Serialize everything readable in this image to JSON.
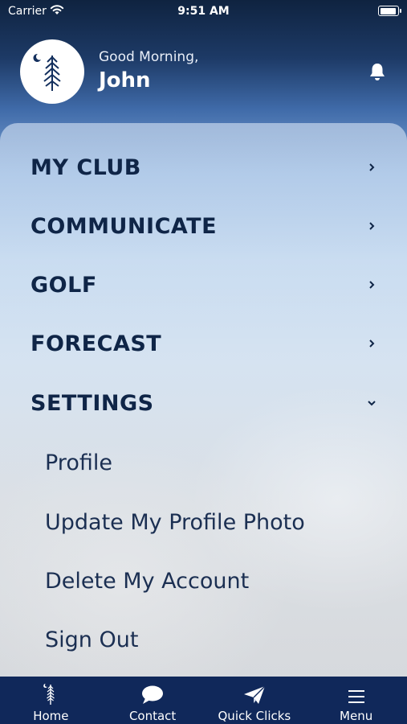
{
  "status_bar": {
    "carrier": "Carrier",
    "time": "9:51 AM"
  },
  "header": {
    "greeting": "Good Morning,",
    "name": "John"
  },
  "colors": {
    "navy": "#10285a",
    "menu_text": "#0f2547"
  },
  "menu": {
    "items": [
      {
        "label": "MY CLUB",
        "icon": "chevron-right-icon"
      },
      {
        "label": "COMMUNICATE",
        "icon": "chevron-right-icon"
      },
      {
        "label": "GOLF",
        "icon": "chevron-right-icon"
      },
      {
        "label": "FORECAST",
        "icon": "chevron-right-icon"
      },
      {
        "label": "SETTINGS",
        "icon": "chevron-down-icon",
        "expanded": true
      }
    ],
    "settings_sub": [
      {
        "label": "Profile"
      },
      {
        "label": "Update My Profile Photo"
      },
      {
        "label": "Delete My Account"
      },
      {
        "label": "Sign Out"
      }
    ]
  },
  "tabbar": {
    "tabs": [
      {
        "label": "Home",
        "icon": "tree-icon"
      },
      {
        "label": "Contact",
        "icon": "chat-bubble-icon"
      },
      {
        "label": "Quick Clicks",
        "icon": "paper-plane-icon"
      },
      {
        "label": "Menu",
        "icon": "hamburger-icon"
      }
    ]
  }
}
